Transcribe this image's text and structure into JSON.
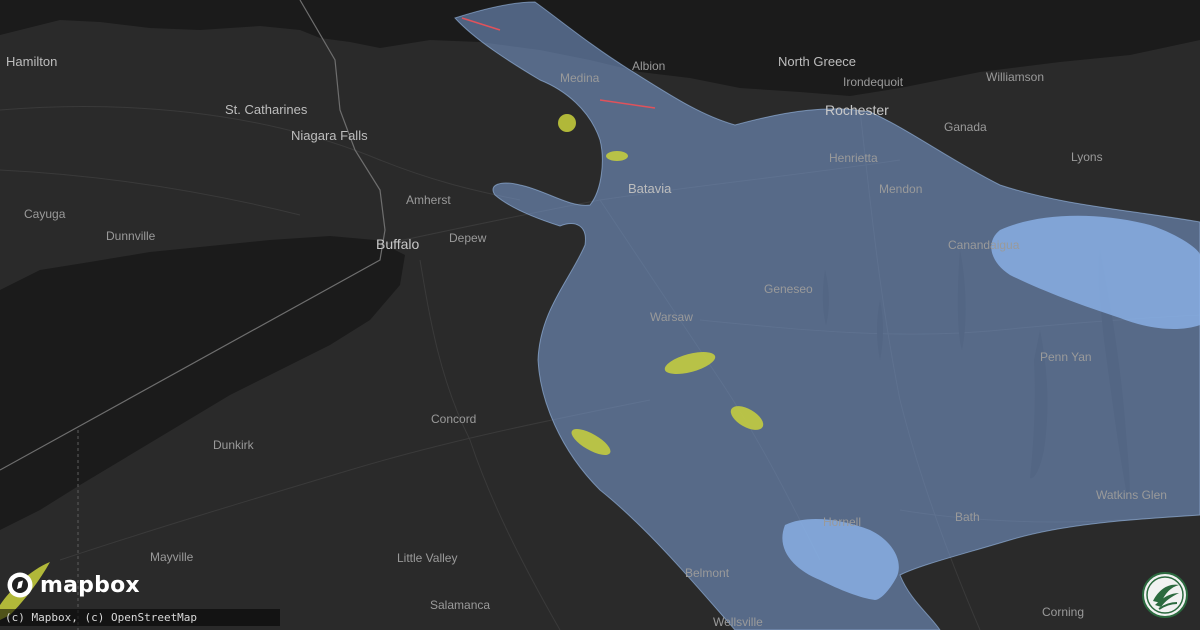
{
  "map": {
    "labels": {
      "hamilton": "Hamilton",
      "st_catharines": "St. Catharines",
      "niagara_falls": "Niagara Falls",
      "amherst": "Amherst",
      "buffalo": "Buffalo",
      "depew": "Depew",
      "cayuga": "Cayuga",
      "dunnville": "Dunnville",
      "dunkirk": "Dunkirk",
      "concord": "Concord",
      "mayville": "Mayville",
      "little_valley": "Little Valley",
      "salamanca": "Salamanca",
      "medina": "Medina",
      "albion": "Albion",
      "batavia": "Batavia",
      "warsaw": "Warsaw",
      "geneseo": "Geneseo",
      "north_greece": "North Greece",
      "irondequoit": "Irondequoit",
      "rochester": "Rochester",
      "henrietta": "Henrietta",
      "mendon": "Mendon",
      "williamson": "Williamson",
      "ganada": "Ganada",
      "lyons": "Lyons",
      "canandaigua": "Canandaigua",
      "penn_yan": "Penn Yan",
      "watkins_glen": "Watkins Glen",
      "hornell": "Hornell",
      "bath": "Bath",
      "belmont": "Belmont",
      "wellsville": "Wellsville",
      "corning": "Corning"
    },
    "colors": {
      "land": "#2a2a2a",
      "water": "#1b1b1b",
      "hail_swath": "#7b9fd6",
      "hail_core": "#8fb8f0",
      "hail_cell": "#c9d13c",
      "wind_report": "#e0525b"
    }
  },
  "branding": {
    "logo_text": "mapbox",
    "logo_icon": "mapbox-logo-icon",
    "badge_icon": "weather-badge-icon"
  },
  "attribution": "(c) Mapbox, (c) OpenStreetMap"
}
